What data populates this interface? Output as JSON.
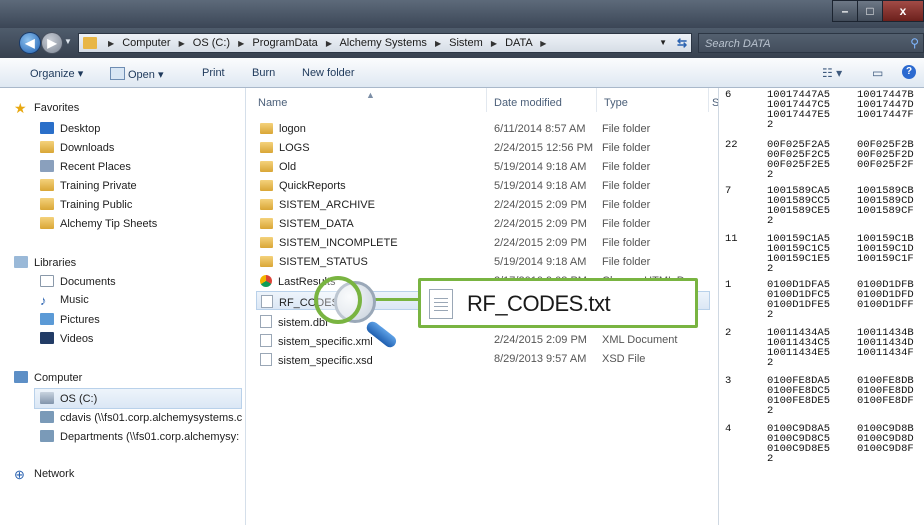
{
  "window": {
    "min_label": "–",
    "max_label": "□",
    "close_label": "x"
  },
  "address": {
    "crumbs": [
      "Computer",
      "OS (C:)",
      "ProgramData",
      "Alchemy Systems",
      "Sistem",
      "DATA"
    ],
    "search_placeholder": "Search DATA"
  },
  "toolbar": {
    "organize": "Organize ▾",
    "open": "Open ▾",
    "print": "Print",
    "burn": "Burn",
    "new_folder": "New folder"
  },
  "nav": {
    "favorites": "Favorites",
    "desktop": "Desktop",
    "downloads": "Downloads",
    "recent": "Recent Places",
    "training_private": "Training Private",
    "training_public": "Training Public",
    "tip_sheets": "Alchemy Tip Sheets",
    "libraries": "Libraries",
    "documents": "Documents",
    "music": "Music",
    "pictures": "Pictures",
    "videos": "Videos",
    "computer": "Computer",
    "os_c": "OS (C:)",
    "cdavis": "cdavis (\\\\fs01.corp.alchemysystems.c",
    "departments": "Departments (\\\\fs01.corp.alchemysy:",
    "network": "Network"
  },
  "columns": {
    "name": "Name",
    "date": "Date modified",
    "type": "Type",
    "size": "S"
  },
  "files": [
    {
      "name": "logon",
      "date": "6/11/2014 8:57 AM",
      "type": "File folder",
      "icon": "folder"
    },
    {
      "name": "LOGS",
      "date": "2/24/2015 12:56 PM",
      "type": "File folder",
      "icon": "folder"
    },
    {
      "name": "Old",
      "date": "5/19/2014 9:18 AM",
      "type": "File folder",
      "icon": "folder"
    },
    {
      "name": "QuickReports",
      "date": "5/19/2014 9:18 AM",
      "type": "File folder",
      "icon": "folder"
    },
    {
      "name": "SISTEM_ARCHIVE",
      "date": "2/24/2015 2:09 PM",
      "type": "File folder",
      "icon": "folder"
    },
    {
      "name": "SISTEM_DATA",
      "date": "2/24/2015 2:09 PM",
      "type": "File folder",
      "icon": "folder"
    },
    {
      "name": "SISTEM_INCOMPLETE",
      "date": "2/24/2015 2:09 PM",
      "type": "File folder",
      "icon": "folder"
    },
    {
      "name": "SISTEM_STATUS",
      "date": "5/19/2014 9:18 AM",
      "type": "File folder",
      "icon": "folder"
    },
    {
      "name": "LastResults",
      "date": "2/17/2010 9:08 PM",
      "type": "Chrome HTML Doc",
      "icon": "chrome"
    },
    {
      "name": "RF_CODES",
      "date": "",
      "type": "",
      "icon": "file"
    },
    {
      "name": "sistem.dbf",
      "date": "",
      "type": "",
      "icon": "file"
    },
    {
      "name": "sistem_specific.xml",
      "date": "2/24/2015 2:09 PM",
      "type": "XML Document",
      "icon": "file"
    },
    {
      "name": "sistem_specific.xsd",
      "date": "8/29/2013 9:57 AM",
      "type": "XSD File",
      "icon": "file"
    }
  ],
  "callout": {
    "filename": "RF_CODES.txt"
  },
  "codes": [
    {
      "n": "6",
      "c1": "10017447A5\n10017447C5\n10017447E5",
      "c2": "10017447B\n10017447D\n10017447F",
      "tail": "2"
    },
    {
      "n": "22",
      "c1": "00F025F2A5\n00F025F2C5\n00F025F2E5",
      "c2": "00F025F2B\n00F025F2D\n00F025F2F",
      "tail": "2"
    },
    {
      "n": "7",
      "c1": "1001589CA5\n1001589CC5\n1001589CE5",
      "c2": "1001589CB\n1001589CD\n1001589CF",
      "tail": "2"
    },
    {
      "n": "11",
      "c1": "100159C1A5\n100159C1C5\n100159C1E5",
      "c2": "100159C1B\n100159C1D\n100159C1F",
      "tail": "2"
    },
    {
      "n": "1",
      "c1": "0100D1DFA5\n0100D1DFC5\n0100D1DFE5",
      "c2": "0100D1DFB\n0100D1DFD\n0100D1DFF",
      "tail": "2"
    },
    {
      "n": "2",
      "c1": "10011434A5\n10011434C5\n10011434E5",
      "c2": "10011434B\n10011434D\n10011434F",
      "tail": "2"
    },
    {
      "n": "3",
      "c1": "0100FE8DA5\n0100FE8DC5\n0100FE8DE5",
      "c2": "0100FE8DB\n0100FE8DD\n0100FE8DF",
      "tail": "2"
    },
    {
      "n": "4",
      "c1": "0100C9D8A5\n0100C9D8C5\n0100C9D8E5",
      "c2": "0100C9D8B\n0100C9D8D\n0100C9D8F",
      "tail": "2"
    }
  ]
}
